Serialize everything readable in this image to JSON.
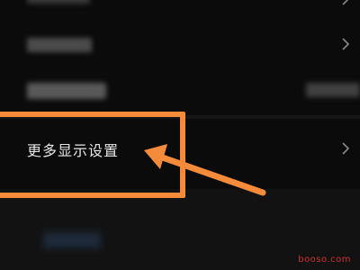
{
  "settings": {
    "more_display_settings_label": "更多显示设置"
  },
  "icons": {
    "chevron": "chevron-right-icon"
  },
  "colors": {
    "highlight": "#f38b3b",
    "watermark": "#d03030"
  },
  "watermark": {
    "text": "booso.com"
  }
}
